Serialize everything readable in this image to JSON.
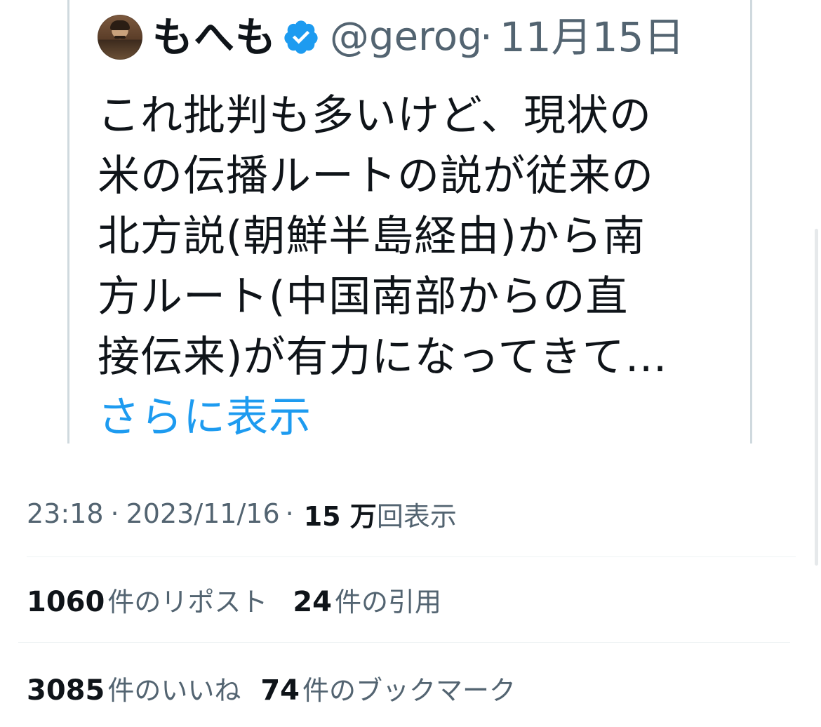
{
  "quoted_tweet": {
    "display_name": "もへも",
    "handle": "@gerog",
    "separator": "·",
    "date": "11月15日",
    "body": "これ批判も多いけど、現状の\n米の伝播ルートの説が従来の\n北方説(朝鮮半島経由)から南\n方ルート(中国南部からの直\n接伝来)が有力になってきて…",
    "show_more_label": "さらに表示",
    "verified_color": "#1d9bf0"
  },
  "meta": {
    "time": "23:18",
    "separator": "·",
    "date": "2023/11/16",
    "views_count": "15 万",
    "views_label": "回表示"
  },
  "stats": {
    "reposts_count": "1060",
    "reposts_label": "件のリポスト",
    "quotes_count": "24",
    "quotes_label": "件の引用",
    "likes_count": "3085",
    "likes_label": "件のいいね",
    "bookmarks_count": "74",
    "bookmarks_label": "件のブックマーク"
  },
  "colors": {
    "text_primary": "#0f1419",
    "text_secondary": "#536471",
    "link": "#1d9bf0",
    "border": "#cfd9de",
    "divider": "#eff3f4"
  }
}
